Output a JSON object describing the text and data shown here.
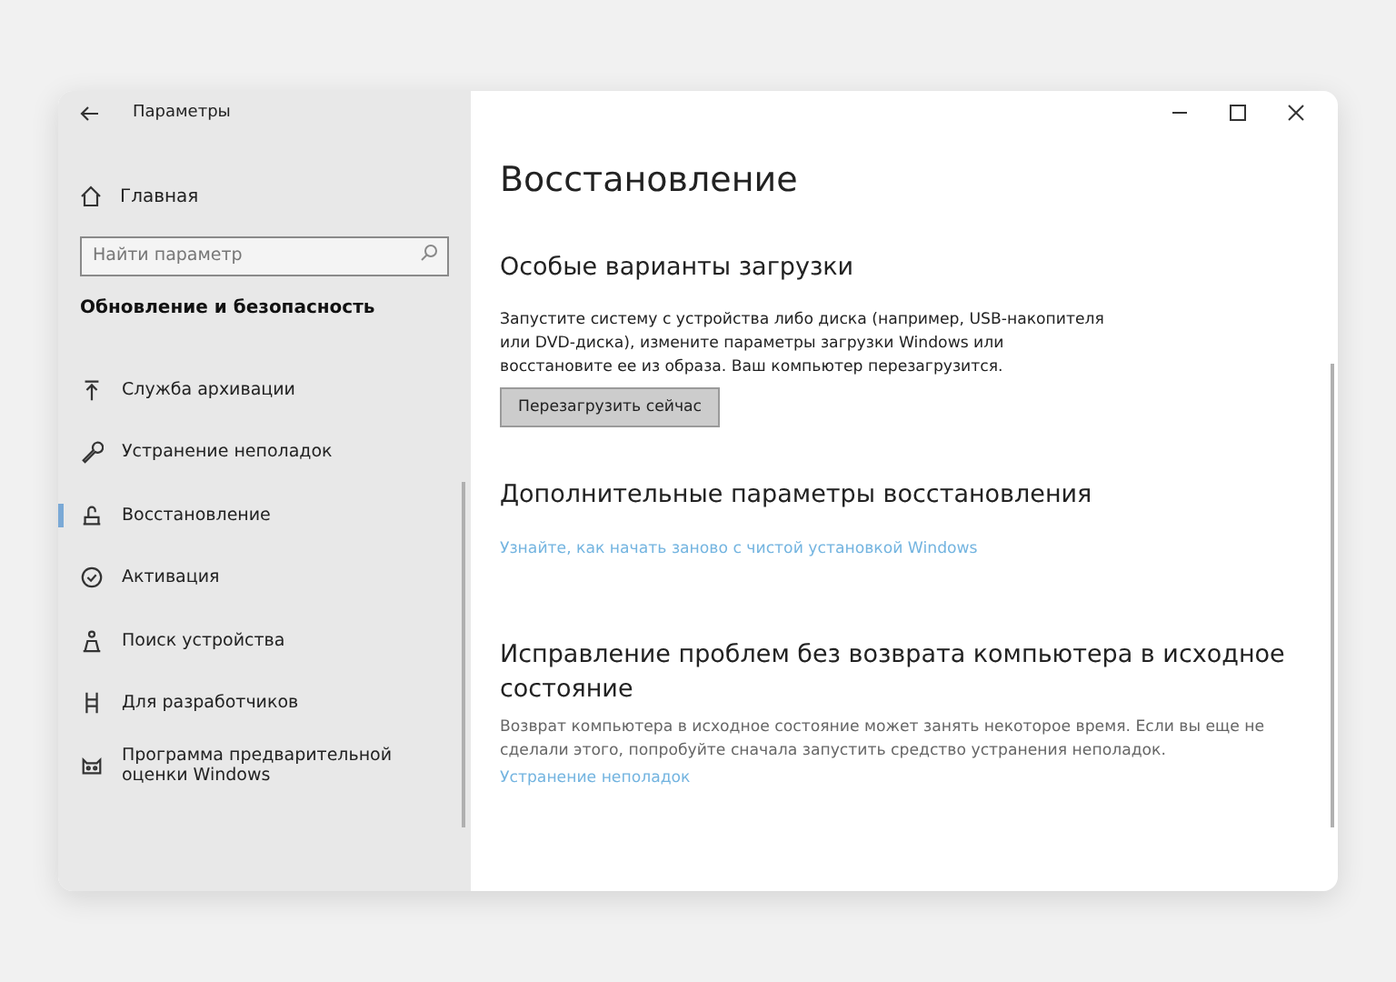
{
  "window": {
    "title": "Параметры"
  },
  "sidebar": {
    "home": "Главная",
    "search": {
      "placeholder": "Найти параметр"
    },
    "section": "Обновление и безопасность",
    "items": [
      {
        "label": "Служба архивации",
        "selected": false
      },
      {
        "label": "Устранение неполадок",
        "selected": false
      },
      {
        "label": "Восстановление",
        "selected": true
      },
      {
        "label": "Активация",
        "selected": false
      },
      {
        "label": "Поиск устройства",
        "selected": false
      },
      {
        "label": "Для разработчиков",
        "selected": false
      },
      {
        "label": "Программа предварительной оценки Windows",
        "selected": false
      }
    ]
  },
  "content": {
    "title": "Восстановление",
    "sections": [
      {
        "heading": "Особые варианты загрузки",
        "text": "Запустите систему с устройства либо диска (например, USB-накопителя или DVD-диска), измените параметры загрузки Windows или восстановите ее из образа. Ваш компьютер перезагрузится.",
        "button": "Перезагрузить сейчас"
      },
      {
        "heading": "Дополнительные параметры восстановления",
        "link": "Узнайте, как начать заново с чистой установкой Windows"
      },
      {
        "heading": "Исправление проблем без возврата компьютера в исходное состояние",
        "note": "Возврат компьютера в исходное состояние может занять некоторое время. Если вы еще не сделали этого, попробуйте сначала запустить средство устранения неполадок.",
        "link": "Устранение неполадок"
      }
    ]
  }
}
